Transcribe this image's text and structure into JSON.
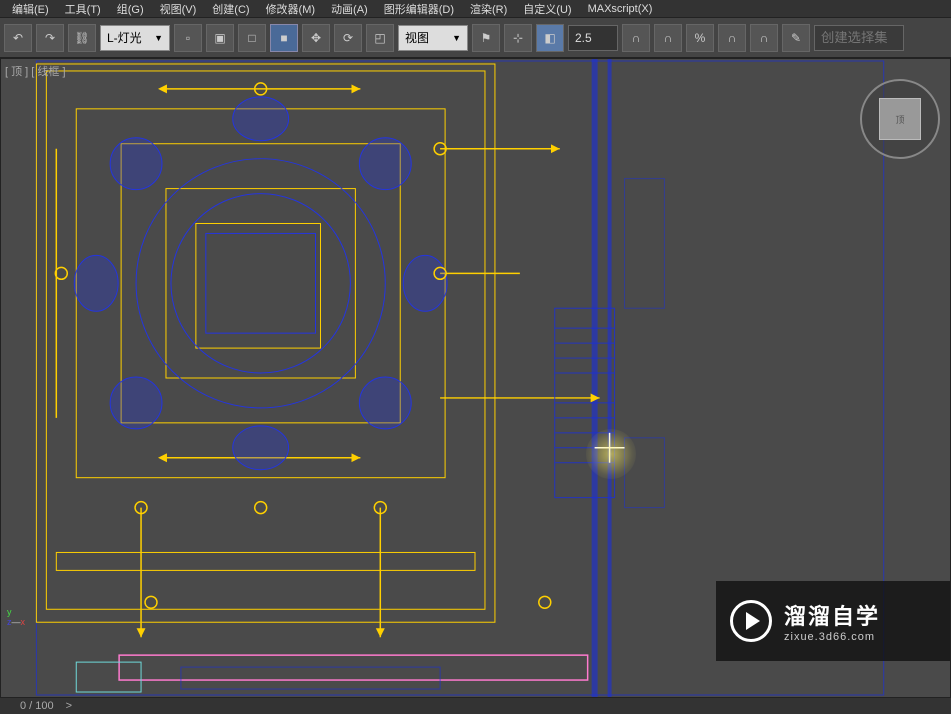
{
  "menu": {
    "edit": "编辑(E)",
    "tool": "工具(T)",
    "group": "组(G)",
    "view": "视图(V)",
    "create": "创建(C)",
    "modifier": "修改器(M)",
    "anim": "动画(A)",
    "graph": "图形编辑器(D)",
    "render": "渲染(R)",
    "custom": "自定义(U)",
    "maxscript": "MAXscript(X)"
  },
  "toolbar": {
    "layer_dropdown": "L-灯光",
    "view_dropdown": "视图",
    "spinner_value": "2.5",
    "selection_set_placeholder": "创建选择集"
  },
  "viewport": {
    "label_1": "[ 顶 ]",
    "label_2": "[ 线框 ]"
  },
  "viewcube": {
    "face": "顶"
  },
  "statusbar": {
    "frame": "0 / 100",
    "expand": ">"
  },
  "watermark": {
    "title": "溜溜自学",
    "subtitle": "zixue.3d66.com"
  },
  "colors": {
    "wire_blue": "#1a2fdc",
    "wire_yellow": "#ffd000",
    "wire_cyan": "#6fdada",
    "wire_pink": "#ff7bcf",
    "wire_dark": "#222",
    "bg": "#4a4a4a"
  }
}
